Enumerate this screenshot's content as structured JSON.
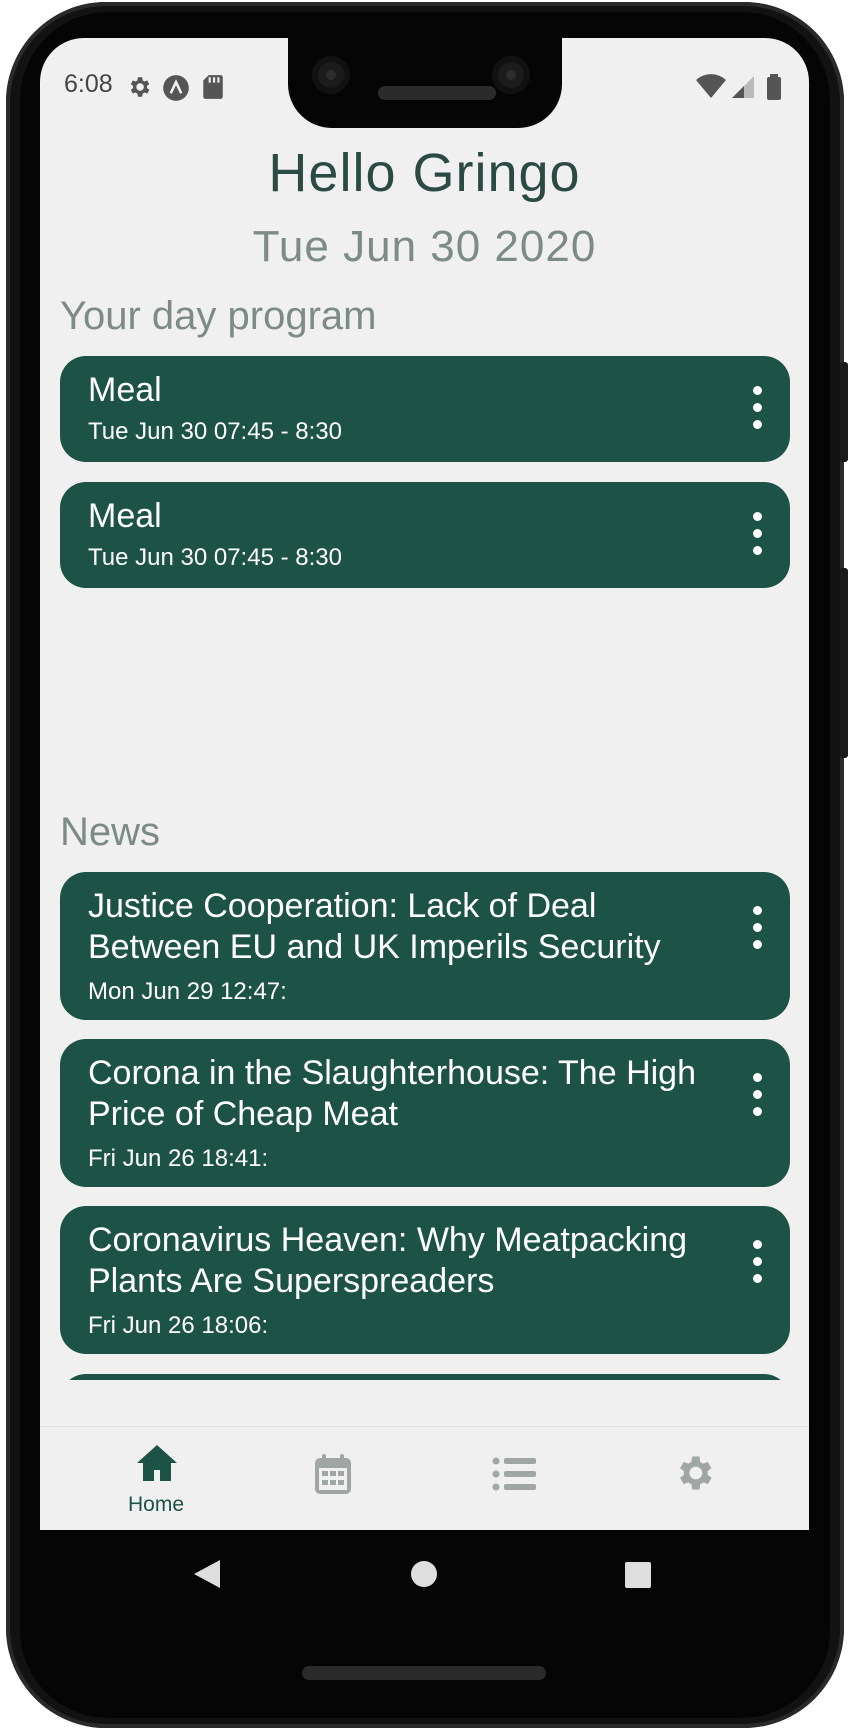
{
  "status_bar": {
    "time": "6:08",
    "left_icons": [
      "gear-icon",
      "a-circle-icon",
      "sd-card-icon"
    ],
    "right_icons": [
      "wifi-icon",
      "signal-icon",
      "battery-icon"
    ]
  },
  "header": {
    "greeting": "Hello Gringo",
    "date": "Tue Jun 30 2020"
  },
  "program": {
    "title": "Your day program",
    "items": [
      {
        "title": "Meal",
        "time": "Tue Jun 30 07:45 - 8:30"
      },
      {
        "title": "Meal",
        "time": "Tue Jun 30 07:45 - 8:30"
      }
    ]
  },
  "news": {
    "title": "News",
    "items": [
      {
        "title_line1": "Justice Cooperation: Lack of Deal",
        "title_line2": "Between EU and UK Imperils Security",
        "date": "Mon Jun 29 12:47:"
      },
      {
        "title_line1": "Corona in the Slaughterhouse: The High",
        "title_line2": "Price of Cheap Meat",
        "date": "Fri Jun 26 18:41:"
      },
      {
        "title_line1": "Coronavirus Heaven: Why Meatpacking",
        "title_line2": "Plants Are Superspreaders",
        "date": "Fri Jun 26 18:06:"
      }
    ]
  },
  "bottom_nav": {
    "items": [
      {
        "label": "Home",
        "icon": "home-icon",
        "active": true
      },
      {
        "label": "",
        "icon": "calendar-icon",
        "active": false
      },
      {
        "label": "",
        "icon": "list-icon",
        "active": false
      },
      {
        "label": "",
        "icon": "settings-icon",
        "active": false
      }
    ]
  },
  "colors": {
    "accent": "#1d5246",
    "background": "#f0f0f0",
    "muted_text": "#7d8b86",
    "inactive_icon": "#a0a6a4"
  }
}
